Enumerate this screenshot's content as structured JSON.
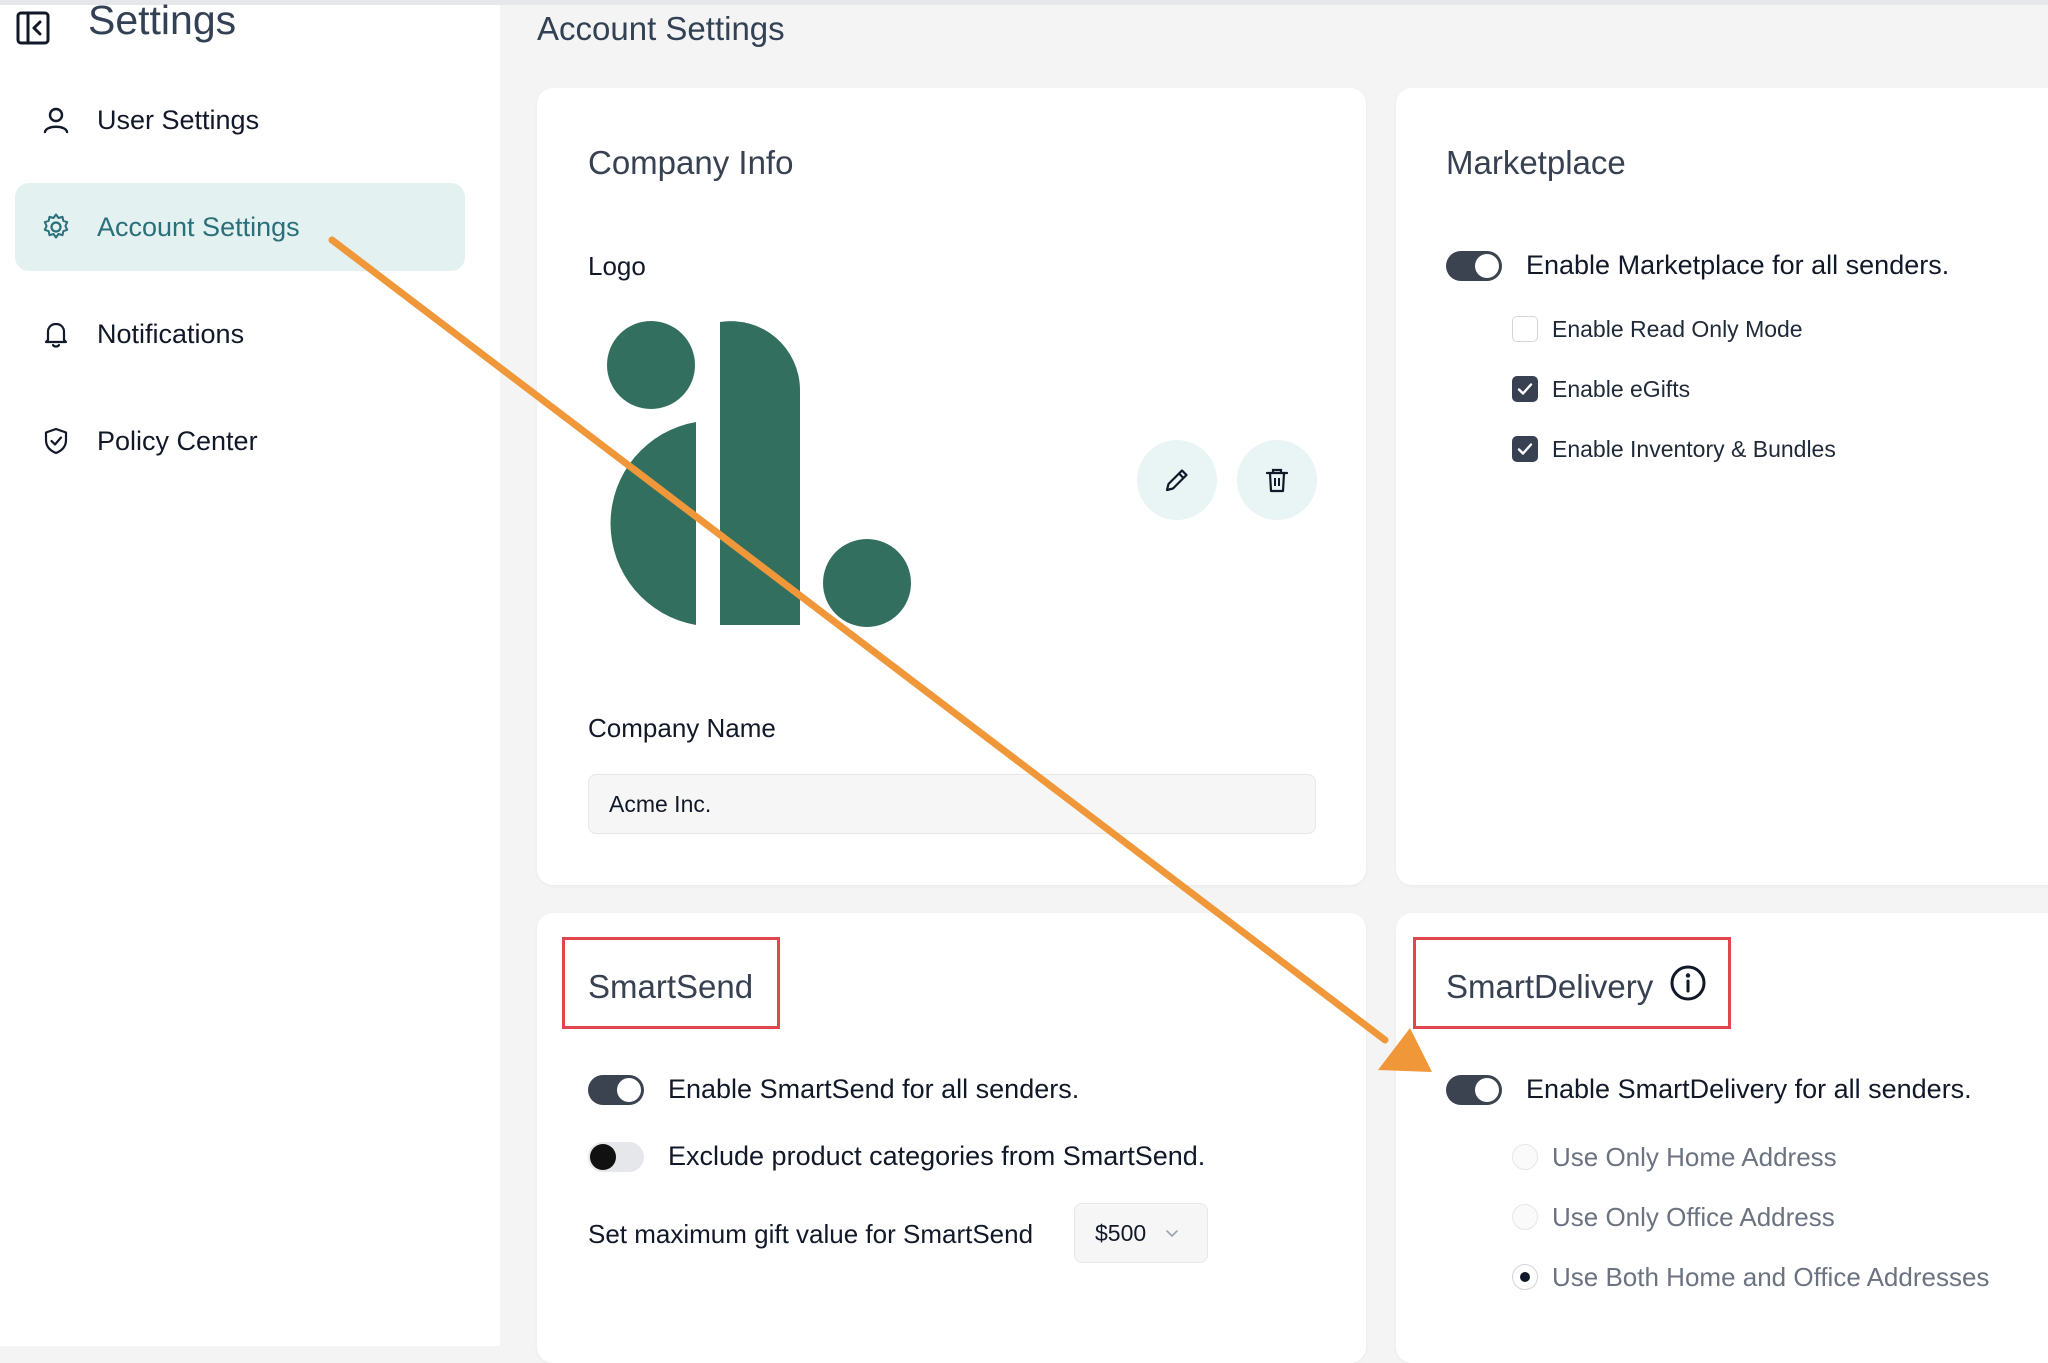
{
  "sidebar": {
    "title": "Settings",
    "items": [
      {
        "label": "User Settings",
        "icon": "user-icon"
      },
      {
        "label": "Account Settings",
        "icon": "gear-icon",
        "active": true
      },
      {
        "label": "Notifications",
        "icon": "bell-icon"
      },
      {
        "label": "Policy Center",
        "icon": "shield-check-icon"
      }
    ]
  },
  "main": {
    "page_title": "Account Settings",
    "company_info": {
      "title": "Company Info",
      "logo_label": "Logo",
      "company_name_label": "Company Name",
      "company_name_value": "Acme Inc.",
      "edit_icon": "pencil-icon",
      "delete_icon": "trash-icon"
    },
    "marketplace": {
      "title": "Marketplace",
      "toggle_label": "Enable Marketplace for all senders.",
      "toggle_on": true,
      "options": [
        {
          "label": "Enable Read Only Mode",
          "checked": false
        },
        {
          "label": "Enable eGifts",
          "checked": true
        },
        {
          "label": "Enable Inventory & Bundles",
          "checked": true
        }
      ]
    },
    "smartsend": {
      "title": "SmartSend",
      "toggles": [
        {
          "label": "Enable SmartSend for all senders.",
          "on": true
        },
        {
          "label": "Exclude product categories from SmartSend.",
          "on": false
        }
      ],
      "max_gift_label": "Set maximum gift value for SmartSend",
      "max_gift_value": "$500"
    },
    "smartdelivery": {
      "title": "SmartDelivery",
      "toggle_label": "Enable SmartDelivery for all senders.",
      "toggle_on": true,
      "radio_options": [
        {
          "label": "Use Only Home Address",
          "selected": false
        },
        {
          "label": "Use Only Office Address",
          "selected": false
        },
        {
          "label": "Use Both Home and Office Addresses",
          "selected": true
        }
      ]
    }
  },
  "colors": {
    "logo_green": "#336f5e",
    "accent_teal": "#2b6f7a",
    "active_bg": "#e3f1f1",
    "toggle_on": "#3b4250",
    "annotation_arrow": "#f0973a",
    "annotation_box": "#e0474c"
  }
}
